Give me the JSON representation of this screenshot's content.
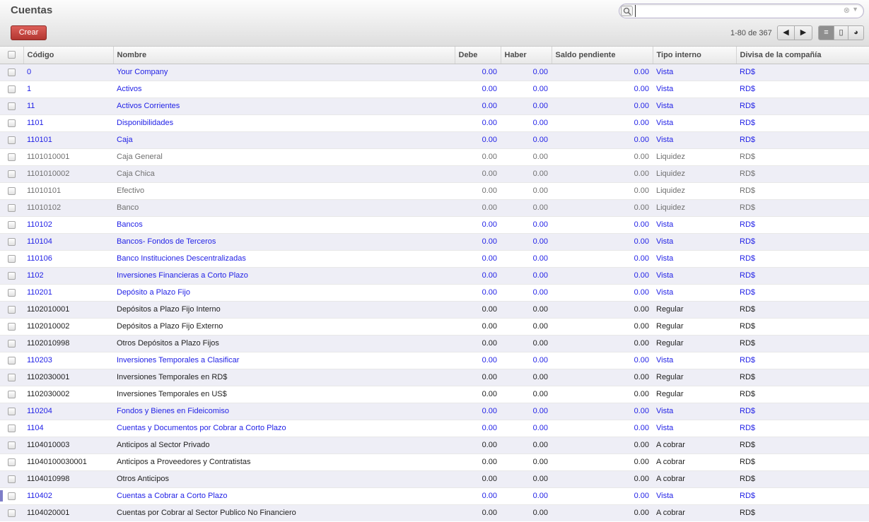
{
  "title": "Cuentas",
  "search": {
    "value": "",
    "placeholder": ""
  },
  "buttons": {
    "create": "Crear"
  },
  "pager": {
    "text": "1-80 de 367"
  },
  "icons": {
    "search": "magnifier-icon",
    "clear": "clear-icon",
    "dropdown": "dropdown-icon",
    "prev": "arrow-left-icon",
    "next": "arrow-right-icon",
    "list_view": "list-view-icon",
    "form_view": "form-view-icon",
    "graph_view": "graph-view-icon"
  },
  "colors": {
    "link": "#1f1fe6",
    "liquidity": "#707070",
    "regular": "#222222",
    "create_button": "#c9443e",
    "odd_row": "#eeeef6"
  },
  "columns": [
    "Código",
    "Nombre",
    "Debe",
    "Haber",
    "Saldo pendiente",
    "Tipo interno",
    "Divisa de la compañía"
  ],
  "rows": [
    {
      "code": "0",
      "name": "Your Company",
      "debit": "0.00",
      "credit": "0.00",
      "balance": "0.00",
      "type": "Vista",
      "currency": "RD$",
      "style": "view"
    },
    {
      "code": "1",
      "name": "Activos",
      "debit": "0.00",
      "credit": "0.00",
      "balance": "0.00",
      "type": "Vista",
      "currency": "RD$",
      "style": "view"
    },
    {
      "code": "11",
      "name": "Activos Corrientes",
      "debit": "0.00",
      "credit": "0.00",
      "balance": "0.00",
      "type": "Vista",
      "currency": "RD$",
      "style": "view"
    },
    {
      "code": "1101",
      "name": "Disponibilidades",
      "debit": "0.00",
      "credit": "0.00",
      "balance": "0.00",
      "type": "Vista",
      "currency": "RD$",
      "style": "view"
    },
    {
      "code": "110101",
      "name": "Caja",
      "debit": "0.00",
      "credit": "0.00",
      "balance": "0.00",
      "type": "Vista",
      "currency": "RD$",
      "style": "view"
    },
    {
      "code": "1101010001",
      "name": "Caja General",
      "debit": "0.00",
      "credit": "0.00",
      "balance": "0.00",
      "type": "Liquidez",
      "currency": "RD$",
      "style": "liq"
    },
    {
      "code": "1101010002",
      "name": "Caja Chica",
      "debit": "0.00",
      "credit": "0.00",
      "balance": "0.00",
      "type": "Liquidez",
      "currency": "RD$",
      "style": "liq"
    },
    {
      "code": "11010101",
      "name": "Efectivo",
      "debit": "0.00",
      "credit": "0.00",
      "balance": "0.00",
      "type": "Liquidez",
      "currency": "RD$",
      "style": "liq"
    },
    {
      "code": "11010102",
      "name": "Banco",
      "debit": "0.00",
      "credit": "0.00",
      "balance": "0.00",
      "type": "Liquidez",
      "currency": "RD$",
      "style": "liq"
    },
    {
      "code": "110102",
      "name": "Bancos",
      "debit": "0.00",
      "credit": "0.00",
      "balance": "0.00",
      "type": "Vista",
      "currency": "RD$",
      "style": "view"
    },
    {
      "code": "110104",
      "name": "Bancos- Fondos de Terceros",
      "debit": "0.00",
      "credit": "0.00",
      "balance": "0.00",
      "type": "Vista",
      "currency": "RD$",
      "style": "view"
    },
    {
      "code": "110106",
      "name": "Banco Instituciones Descentralizadas",
      "debit": "0.00",
      "credit": "0.00",
      "balance": "0.00",
      "type": "Vista",
      "currency": "RD$",
      "style": "view"
    },
    {
      "code": "1102",
      "name": "Inversiones Financieras a Corto Plazo",
      "debit": "0.00",
      "credit": "0.00",
      "balance": "0.00",
      "type": "Vista",
      "currency": "RD$",
      "style": "view"
    },
    {
      "code": "110201",
      "name": "Depósito a Plazo Fijo",
      "debit": "0.00",
      "credit": "0.00",
      "balance": "0.00",
      "type": "Vista",
      "currency": "RD$",
      "style": "view"
    },
    {
      "code": "1102010001",
      "name": "Depósitos a Plazo Fijo Interno",
      "debit": "0.00",
      "credit": "0.00",
      "balance": "0.00",
      "type": "Regular",
      "currency": "RD$",
      "style": "reg"
    },
    {
      "code": "1102010002",
      "name": "Depósitos a Plazo Fijo Externo",
      "debit": "0.00",
      "credit": "0.00",
      "balance": "0.00",
      "type": "Regular",
      "currency": "RD$",
      "style": "reg"
    },
    {
      "code": "1102010998",
      "name": "Otros Depósitos a Plazo Fijos",
      "debit": "0.00",
      "credit": "0.00",
      "balance": "0.00",
      "type": "Regular",
      "currency": "RD$",
      "style": "reg"
    },
    {
      "code": "110203",
      "name": "Inversiones Temporales a Clasificar",
      "debit": "0.00",
      "credit": "0.00",
      "balance": "0.00",
      "type": "Vista",
      "currency": "RD$",
      "style": "view"
    },
    {
      "code": "1102030001",
      "name": "Inversiones Temporales en RD$",
      "debit": "0.00",
      "credit": "0.00",
      "balance": "0.00",
      "type": "Regular",
      "currency": "RD$",
      "style": "reg"
    },
    {
      "code": "1102030002",
      "name": "Inversiones Temporales en US$",
      "debit": "0.00",
      "credit": "0.00",
      "balance": "0.00",
      "type": "Regular",
      "currency": "RD$",
      "style": "reg"
    },
    {
      "code": "110204",
      "name": "Fondos y Bienes en Fideicomiso",
      "debit": "0.00",
      "credit": "0.00",
      "balance": "0.00",
      "type": "Vista",
      "currency": "RD$",
      "style": "view"
    },
    {
      "code": "1104",
      "name": "Cuentas y Documentos por Cobrar a Corto Plazo",
      "debit": "0.00",
      "credit": "0.00",
      "balance": "0.00",
      "type": "Vista",
      "currency": "RD$",
      "style": "view"
    },
    {
      "code": "1104010003",
      "name": "Anticipos al Sector Privado",
      "debit": "0.00",
      "credit": "0.00",
      "balance": "0.00",
      "type": "A cobrar",
      "currency": "RD$",
      "style": "reg"
    },
    {
      "code": "11040100030001",
      "name": "Anticipos a Proveedores y Contratistas",
      "debit": "0.00",
      "credit": "0.00",
      "balance": "0.00",
      "type": "A cobrar",
      "currency": "RD$",
      "style": "reg"
    },
    {
      "code": "1104010998",
      "name": "Otros Anticipos",
      "debit": "0.00",
      "credit": "0.00",
      "balance": "0.00",
      "type": "A cobrar",
      "currency": "RD$",
      "style": "reg"
    },
    {
      "code": "110402",
      "name": "Cuentas a Cobrar a Corto Plazo",
      "debit": "0.00",
      "credit": "0.00",
      "balance": "0.00",
      "type": "Vista",
      "currency": "RD$",
      "style": "view"
    },
    {
      "code": "1104020001",
      "name": "Cuentas por Cobrar al Sector Publico No Financiero",
      "debit": "0.00",
      "credit": "0.00",
      "balance": "0.00",
      "type": "A cobrar",
      "currency": "RD$",
      "style": "reg"
    }
  ]
}
